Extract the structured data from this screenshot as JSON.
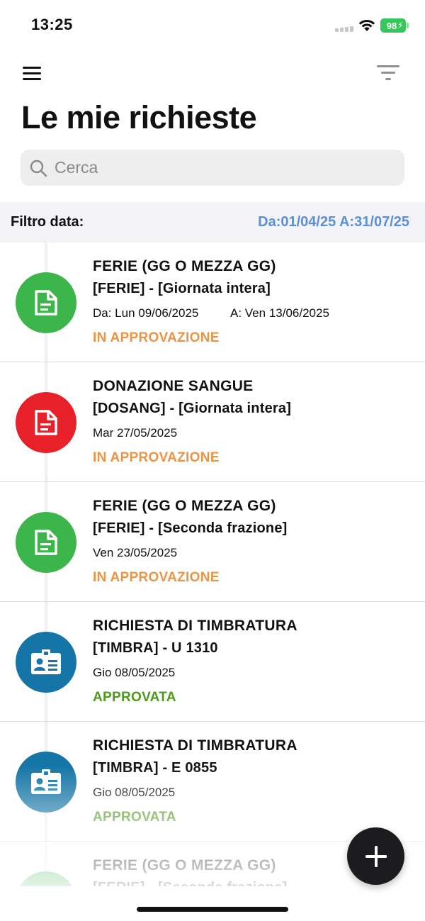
{
  "status_bar": {
    "time": "13:25",
    "battery": "98"
  },
  "header": {
    "title": "Le mie richieste"
  },
  "search": {
    "placeholder": "Cerca"
  },
  "filter_bar": {
    "label": "Filtro data:",
    "range": "Da:01/04/25 A:31/07/25"
  },
  "colors": {
    "green_icon": "#3cb64a",
    "red_icon": "#e8202a",
    "blue_icon": "#1575a6",
    "status_pending": "#ec9446",
    "status_approved": "#4f9a1d",
    "filter_range": "#5b8fd6"
  },
  "requests": [
    {
      "icon": "document-icon",
      "icon_color": "#3cb64a",
      "title": "FERIE (GG O MEZZA GG)",
      "subtitle": "[FERIE] - [Giornata intera]",
      "date": "Da: Lun 09/06/2025",
      "date_to": "A: Ven 13/06/2025",
      "status": "IN APPROVAZIONE",
      "status_color": "#ec9446"
    },
    {
      "icon": "document-icon",
      "icon_color": "#e8202a",
      "title": "DONAZIONE SANGUE",
      "subtitle": "[DOSANG] - [Giornata intera]",
      "date": "Mar 27/05/2025",
      "date_to": "",
      "status": "IN APPROVAZIONE",
      "status_color": "#ec9446"
    },
    {
      "icon": "document-icon",
      "icon_color": "#3cb64a",
      "title": "FERIE (GG O MEZZA GG)",
      "subtitle": "[FERIE] - [Seconda frazione]",
      "date": "Ven 23/05/2025",
      "date_to": "",
      "status": "IN APPROVAZIONE",
      "status_color": "#ec9446"
    },
    {
      "icon": "id-card-icon",
      "icon_color": "#1575a6",
      "title": "RICHIESTA DI TIMBRATURA",
      "subtitle": "[TIMBRA] - U 1310",
      "date": "Gio 08/05/2025",
      "date_to": "",
      "status": "APPROVATA",
      "status_color": "#4f9a1d"
    },
    {
      "icon": "id-card-icon",
      "icon_color": "#1575a6",
      "title": "RICHIESTA DI TIMBRATURA",
      "subtitle": "[TIMBRA] - E 0855",
      "date": "Gio 08/05/2025",
      "date_to": "",
      "status": "APPROVATA",
      "status_color": "#4f9a1d"
    },
    {
      "icon": "document-icon",
      "icon_color": "#3cb64a",
      "title": "FERIE (GG O MEZZA GG)",
      "subtitle": "[FERIE] - [Seconda frazione]",
      "date": "",
      "date_to": "",
      "status": "",
      "status_color": "#ec9446"
    }
  ]
}
